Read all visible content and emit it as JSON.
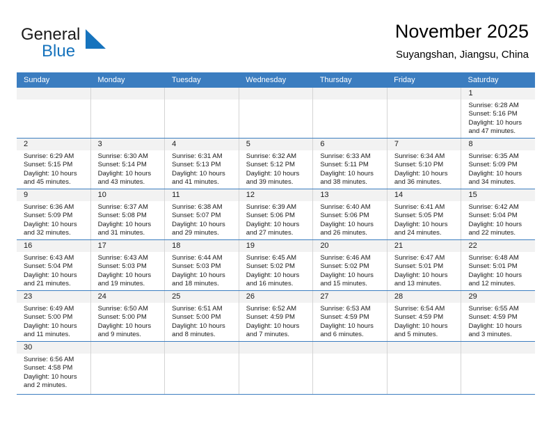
{
  "brand": {
    "name_part1": "General",
    "name_part2": "Blue",
    "mark_icon": "blue-triangle-icon",
    "accent_color": "#1673bd"
  },
  "header": {
    "title": "November 2025",
    "subtitle": "Suyangshan, Jiangsu, China"
  },
  "theme": {
    "header_blue": "#3b7dc0",
    "day_strip_gray": "#f2f2f2",
    "grid_line": "#d4d4d4"
  },
  "weekdays": [
    "Sunday",
    "Monday",
    "Tuesday",
    "Wednesday",
    "Thursday",
    "Friday",
    "Saturday"
  ],
  "labels": {
    "sunrise": "Sunrise:",
    "sunset": "Sunset:",
    "daylight": "Daylight:"
  },
  "weeks": [
    [
      {
        "day": "",
        "empty": true
      },
      {
        "day": "",
        "empty": true
      },
      {
        "day": "",
        "empty": true
      },
      {
        "day": "",
        "empty": true
      },
      {
        "day": "",
        "empty": true
      },
      {
        "day": "",
        "empty": true
      },
      {
        "day": "1",
        "sunrise": "Sunrise: 6:28 AM",
        "sunset": "Sunset: 5:16 PM",
        "daylight": "Daylight: 10 hours and 47 minutes."
      }
    ],
    [
      {
        "day": "2",
        "sunrise": "Sunrise: 6:29 AM",
        "sunset": "Sunset: 5:15 PM",
        "daylight": "Daylight: 10 hours and 45 minutes."
      },
      {
        "day": "3",
        "sunrise": "Sunrise: 6:30 AM",
        "sunset": "Sunset: 5:14 PM",
        "daylight": "Daylight: 10 hours and 43 minutes."
      },
      {
        "day": "4",
        "sunrise": "Sunrise: 6:31 AM",
        "sunset": "Sunset: 5:13 PM",
        "daylight": "Daylight: 10 hours and 41 minutes."
      },
      {
        "day": "5",
        "sunrise": "Sunrise: 6:32 AM",
        "sunset": "Sunset: 5:12 PM",
        "daylight": "Daylight: 10 hours and 39 minutes."
      },
      {
        "day": "6",
        "sunrise": "Sunrise: 6:33 AM",
        "sunset": "Sunset: 5:11 PM",
        "daylight": "Daylight: 10 hours and 38 minutes."
      },
      {
        "day": "7",
        "sunrise": "Sunrise: 6:34 AM",
        "sunset": "Sunset: 5:10 PM",
        "daylight": "Daylight: 10 hours and 36 minutes."
      },
      {
        "day": "8",
        "sunrise": "Sunrise: 6:35 AM",
        "sunset": "Sunset: 5:09 PM",
        "daylight": "Daylight: 10 hours and 34 minutes."
      }
    ],
    [
      {
        "day": "9",
        "sunrise": "Sunrise: 6:36 AM",
        "sunset": "Sunset: 5:09 PM",
        "daylight": "Daylight: 10 hours and 32 minutes."
      },
      {
        "day": "10",
        "sunrise": "Sunrise: 6:37 AM",
        "sunset": "Sunset: 5:08 PM",
        "daylight": "Daylight: 10 hours and 31 minutes."
      },
      {
        "day": "11",
        "sunrise": "Sunrise: 6:38 AM",
        "sunset": "Sunset: 5:07 PM",
        "daylight": "Daylight: 10 hours and 29 minutes."
      },
      {
        "day": "12",
        "sunrise": "Sunrise: 6:39 AM",
        "sunset": "Sunset: 5:06 PM",
        "daylight": "Daylight: 10 hours and 27 minutes."
      },
      {
        "day": "13",
        "sunrise": "Sunrise: 6:40 AM",
        "sunset": "Sunset: 5:06 PM",
        "daylight": "Daylight: 10 hours and 26 minutes."
      },
      {
        "day": "14",
        "sunrise": "Sunrise: 6:41 AM",
        "sunset": "Sunset: 5:05 PM",
        "daylight": "Daylight: 10 hours and 24 minutes."
      },
      {
        "day": "15",
        "sunrise": "Sunrise: 6:42 AM",
        "sunset": "Sunset: 5:04 PM",
        "daylight": "Daylight: 10 hours and 22 minutes."
      }
    ],
    [
      {
        "day": "16",
        "sunrise": "Sunrise: 6:43 AM",
        "sunset": "Sunset: 5:04 PM",
        "daylight": "Daylight: 10 hours and 21 minutes."
      },
      {
        "day": "17",
        "sunrise": "Sunrise: 6:43 AM",
        "sunset": "Sunset: 5:03 PM",
        "daylight": "Daylight: 10 hours and 19 minutes."
      },
      {
        "day": "18",
        "sunrise": "Sunrise: 6:44 AM",
        "sunset": "Sunset: 5:03 PM",
        "daylight": "Daylight: 10 hours and 18 minutes."
      },
      {
        "day": "19",
        "sunrise": "Sunrise: 6:45 AM",
        "sunset": "Sunset: 5:02 PM",
        "daylight": "Daylight: 10 hours and 16 minutes."
      },
      {
        "day": "20",
        "sunrise": "Sunrise: 6:46 AM",
        "sunset": "Sunset: 5:02 PM",
        "daylight": "Daylight: 10 hours and 15 minutes."
      },
      {
        "day": "21",
        "sunrise": "Sunrise: 6:47 AM",
        "sunset": "Sunset: 5:01 PM",
        "daylight": "Daylight: 10 hours and 13 minutes."
      },
      {
        "day": "22",
        "sunrise": "Sunrise: 6:48 AM",
        "sunset": "Sunset: 5:01 PM",
        "daylight": "Daylight: 10 hours and 12 minutes."
      }
    ],
    [
      {
        "day": "23",
        "sunrise": "Sunrise: 6:49 AM",
        "sunset": "Sunset: 5:00 PM",
        "daylight": "Daylight: 10 hours and 11 minutes."
      },
      {
        "day": "24",
        "sunrise": "Sunrise: 6:50 AM",
        "sunset": "Sunset: 5:00 PM",
        "daylight": "Daylight: 10 hours and 9 minutes."
      },
      {
        "day": "25",
        "sunrise": "Sunrise: 6:51 AM",
        "sunset": "Sunset: 5:00 PM",
        "daylight": "Daylight: 10 hours and 8 minutes."
      },
      {
        "day": "26",
        "sunrise": "Sunrise: 6:52 AM",
        "sunset": "Sunset: 4:59 PM",
        "daylight": "Daylight: 10 hours and 7 minutes."
      },
      {
        "day": "27",
        "sunrise": "Sunrise: 6:53 AM",
        "sunset": "Sunset: 4:59 PM",
        "daylight": "Daylight: 10 hours and 6 minutes."
      },
      {
        "day": "28",
        "sunrise": "Sunrise: 6:54 AM",
        "sunset": "Sunset: 4:59 PM",
        "daylight": "Daylight: 10 hours and 5 minutes."
      },
      {
        "day": "29",
        "sunrise": "Sunrise: 6:55 AM",
        "sunset": "Sunset: 4:59 PM",
        "daylight": "Daylight: 10 hours and 3 minutes."
      }
    ],
    [
      {
        "day": "30",
        "sunrise": "Sunrise: 6:56 AM",
        "sunset": "Sunset: 4:58 PM",
        "daylight": "Daylight: 10 hours and 2 minutes."
      },
      {
        "day": "",
        "empty": true
      },
      {
        "day": "",
        "empty": true
      },
      {
        "day": "",
        "empty": true
      },
      {
        "day": "",
        "empty": true
      },
      {
        "day": "",
        "empty": true
      },
      {
        "day": "",
        "empty": true
      }
    ]
  ]
}
